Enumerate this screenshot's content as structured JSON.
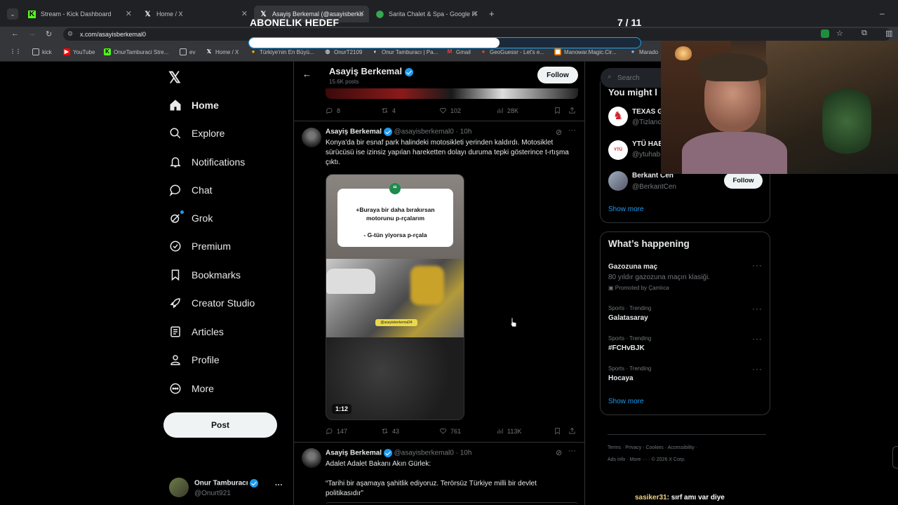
{
  "browser": {
    "tabs": [
      {
        "label": "Stream - Kick Dashboard"
      },
      {
        "label": "Home / X"
      },
      {
        "label": "Asayiş Berkemal (@asayisberke"
      },
      {
        "label": "Sarita Chalet & Spa - Google H"
      }
    ],
    "url": "x.com/asayisberkemal0",
    "bookmarks": [
      "kick",
      "YouTube",
      "OnurTamburaci Stre...",
      "ev",
      "Home / X",
      "Türkiye'nin En Büyü...",
      "OnurT2109",
      "Onur Tamburacı | Pa...",
      "Gmail",
      "GeoGuessr - Let's e...",
      "Manowar.Magic.Cir...",
      "Marado"
    ]
  },
  "overlay": {
    "goal_title": "ABONELIK HEDEF",
    "goal_count": "7 / 11",
    "goal_progress": 0.64
  },
  "nav": {
    "items": [
      {
        "label": "Home"
      },
      {
        "label": "Explore"
      },
      {
        "label": "Notifications"
      },
      {
        "label": "Chat"
      },
      {
        "label": "Grok"
      },
      {
        "label": "Premium"
      },
      {
        "label": "Bookmarks"
      },
      {
        "label": "Creator Studio"
      },
      {
        "label": "Articles"
      },
      {
        "label": "Profile"
      },
      {
        "label": "More"
      }
    ],
    "post_label": "Post",
    "account": {
      "name": "Onur Tamburacı",
      "handle": "@Onurt921"
    }
  },
  "profile_header": {
    "name": "Asayiş Berkemal",
    "posts": "15.6K posts",
    "follow_label": "Follow"
  },
  "prev_post_stats": {
    "replies": "8",
    "reposts": "4",
    "likes": "102",
    "views": "28K"
  },
  "post1": {
    "name": "Asayiş Berkemal",
    "handle": "@asayisberkemal0",
    "time": "10h",
    "text": "Konya'da bir esnaf park halindeki motosikleti yerinden kaldırdı. Motosiklet sürücüsü ise izinsiz yapılan hareketten dolayı duruma tepki gösterince t-rtışma çıktı.",
    "quote_line1": "+Buraya bir daha bırakırsan",
    "quote_line2": "motorunu p-rçalarım",
    "quote_line3": "- G-tün yiyorsa p-rçala",
    "watermark": "@asayisberkemal34",
    "duration": "1:12",
    "stats": {
      "replies": "147",
      "reposts": "43",
      "likes": "761",
      "views": "113K"
    }
  },
  "post2": {
    "name": "Asayiş Berkemal",
    "handle": "@asayisberkemal0",
    "time": "10h",
    "line1": "Adalet Adalet Bakanı Akın Gürlek:",
    "line2": "“Tarihi bir aşamaya şahitlik ediyoruz. Terörsüz Türkiye milli bir devlet politikasıdır”"
  },
  "right": {
    "search_placeholder": "Search",
    "wtf_title": "You might l",
    "wtf": [
      {
        "name": "TEXAS G",
        "handle": "@Tizlanc"
      },
      {
        "name": "YTÜ HAB",
        "handle": "@ytuhab"
      },
      {
        "name": "Berkant Cen",
        "handle": "@BerkantCen",
        "follow": "Follow"
      }
    ],
    "show_more": "Show more",
    "happening_title": "What’s happening",
    "trends": [
      {
        "meta": "",
        "title": "Gazozuna maç",
        "sub": "80 yıldır gazozuna maçın klasiği.",
        "promo": "Promoted by Çamlıca"
      },
      {
        "meta": "Sports · Trending",
        "title": "Galatasaray"
      },
      {
        "meta": "Sports · Trending",
        "title": "#FCHvBJK"
      },
      {
        "meta": "Sports · Trending",
        "title": "Hocaya"
      }
    ],
    "show_more2": "Show more",
    "footer1": [
      "Terms",
      "Privacy",
      "Cookies",
      "Accessibility"
    ],
    "footer2": [
      "Ads info",
      "More ···",
      "© 2026 X Corp."
    ]
  },
  "chat": {
    "user": "sasiker31",
    "message": ": sırf amı var diye"
  },
  "colors": {
    "accent": "#1d9bf0",
    "bg": "#000000",
    "border": "#2f3336",
    "muted": "#71767b"
  }
}
